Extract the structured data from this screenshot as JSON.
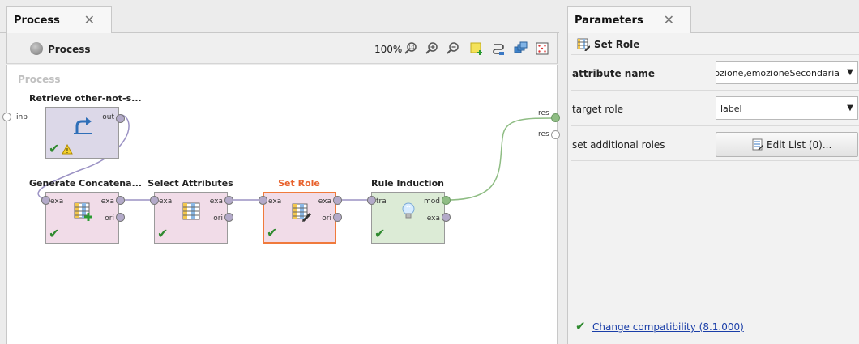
{
  "process_panel": {
    "tab_label": "Process",
    "breadcrumb": "Process",
    "zoom": "100%",
    "canvas_label": "Process",
    "toolbar_icons": [
      "zoom-fit-icon",
      "zoom-in-icon",
      "zoom-out-icon",
      "add-note-icon",
      "auto-wire-icon",
      "arrange-operators-icon",
      "show-grid-icon"
    ]
  },
  "operators": {
    "retrieve": {
      "title": "Retrieve other-not-s...",
      "out_port": "out",
      "status": [
        "ok",
        "warning"
      ]
    },
    "generate": {
      "title": "Generate Concatena...",
      "in_port": "exa",
      "out_ports": [
        "exa",
        "ori"
      ],
      "status": "ok"
    },
    "select": {
      "title": "Select Attributes",
      "in_port": "exa",
      "out_ports": [
        "exa",
        "ori"
      ],
      "status": "ok"
    },
    "setrole": {
      "title": "Set Role",
      "in_port": "exa",
      "out_ports": [
        "exa",
        "ori"
      ],
      "status": "ok",
      "selected": true
    },
    "rule": {
      "title": "Rule Induction",
      "in_port": "tra",
      "out_ports": [
        "mod",
        "exa"
      ],
      "status": "ok"
    }
  },
  "process_ports": {
    "input": "inp",
    "results": [
      "res",
      "res"
    ]
  },
  "params_panel": {
    "tab_label": "Parameters",
    "operator_name": "Set Role",
    "rows": [
      {
        "label": "attribute name",
        "type": "combo",
        "value": "emozione,emozioneSecondaria"
      },
      {
        "label": "target role",
        "type": "combo",
        "value": "label"
      },
      {
        "label": "set additional roles",
        "type": "button",
        "value": "Edit List (0)..."
      }
    ],
    "compat_link": "Change compatibility (8.1.000)"
  },
  "colors": {
    "retrieve_fill": "#dcd8e8",
    "op_fill": "#f1dce8",
    "model_fill": "#dcebd6",
    "selected_border": "#f07a3c",
    "selected_title": "#e8612c",
    "wire": "#9b92c4",
    "model_wire": "#8fbd84",
    "link": "#1a3ea8"
  }
}
